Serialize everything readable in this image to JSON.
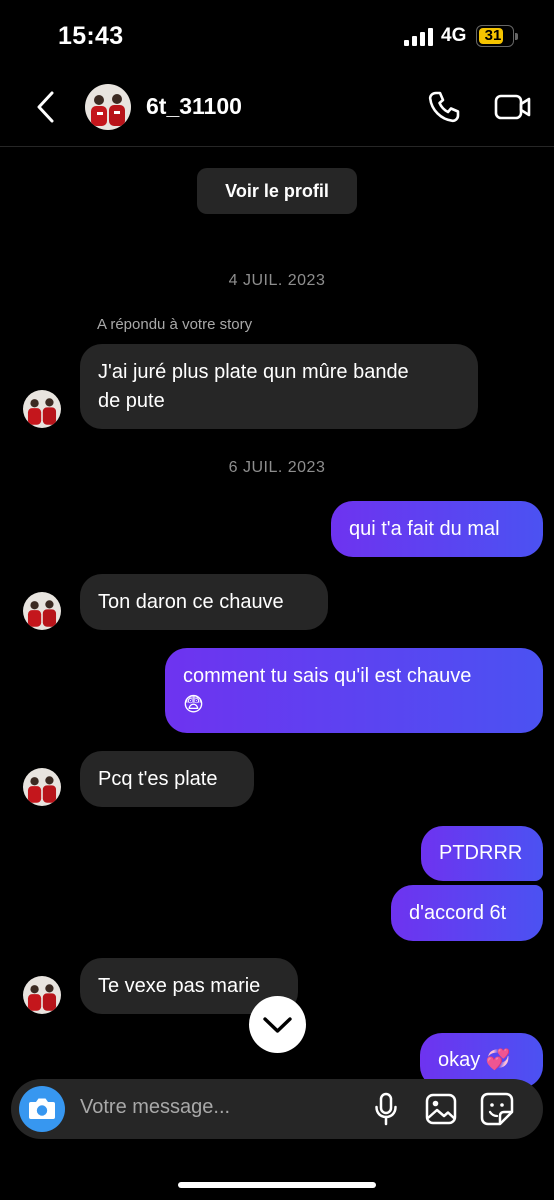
{
  "status_bar": {
    "time": "15:43",
    "network": "4G",
    "battery": "31"
  },
  "header": {
    "username": "6t_31100"
  },
  "profile_button": "Voir le profil",
  "composer": {
    "placeholder": "Votre message..."
  },
  "colors": {
    "outgoing_start": "#6e33f0",
    "outgoing_end": "#4b52f2",
    "incoming": "#262626",
    "accent": "#3797f0"
  },
  "messages": [
    {
      "type": "date",
      "text": "4 JUIL. 2023"
    },
    {
      "type": "note",
      "text": "A répondu à votre story"
    },
    {
      "type": "incoming",
      "line1": "J'ai juré plus plate qun mûre bande",
      "line2": "de pute"
    },
    {
      "type": "date",
      "text": "6 JUIL. 2023"
    },
    {
      "type": "outgoing",
      "text": "qui t'a fait du mal"
    },
    {
      "type": "incoming",
      "text": "Ton daron ce chauve"
    },
    {
      "type": "outgoing",
      "line1": "comment tu sais qu'il est chauve",
      "line2": "😨"
    },
    {
      "type": "incoming",
      "text": "Pcq t'es plate"
    },
    {
      "type": "outgoing",
      "text": "PTDRRR"
    },
    {
      "type": "outgoing",
      "text": "d'accord 6t"
    },
    {
      "type": "incoming",
      "text": "Te vexe pas marie"
    },
    {
      "type": "outgoing",
      "text": "okay 💞"
    }
  ]
}
